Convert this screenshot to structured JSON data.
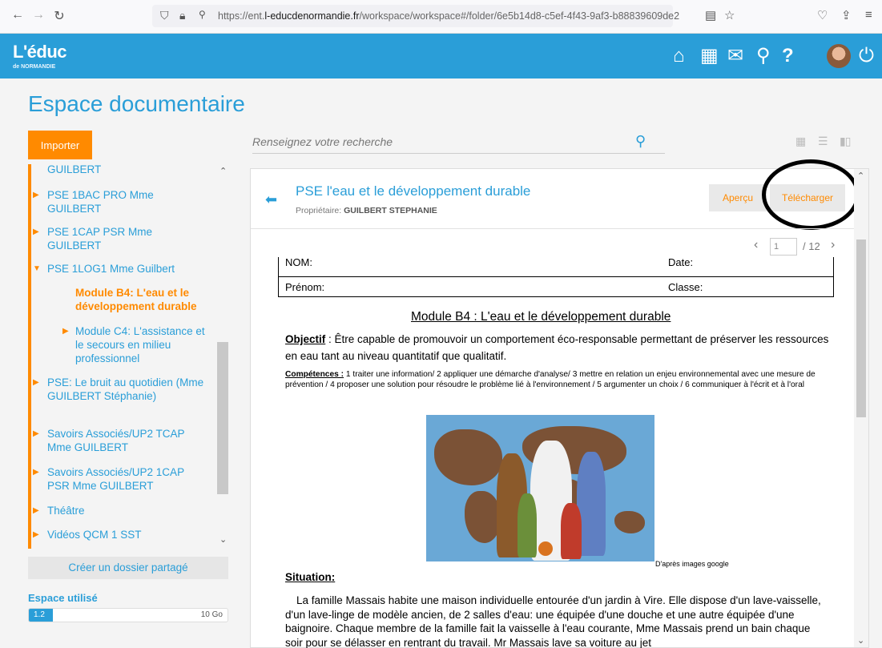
{
  "browser": {
    "url_prefix": "https://ent.",
    "url_domain": "l-educdenormandie.fr",
    "url_path": "/workspace/workspace#/folder/6e5b14d8-c5ef-4f43-9af3-b88839609de2"
  },
  "app": {
    "logo": "L'éduc",
    "logo_sub": "de NORMANDIE"
  },
  "page": {
    "title": "Espace documentaire"
  },
  "sidebar": {
    "import_label": "Importer",
    "items": [
      {
        "label": "GUILBERT"
      },
      {
        "label": "PSE 1BAC PRO Mme GUILBERT"
      },
      {
        "label": "PSE 1CAP PSR Mme GUILBERT"
      },
      {
        "label": "PSE 1LOG1 Mme Guilbert"
      },
      {
        "label": "Module B4: L'eau et le développement durable"
      },
      {
        "label": "Module C4: L'assistance et le secours en milieu professionnel"
      },
      {
        "label": "PSE: Le bruit au quotidien (Mme GUILBERT Stéphanie)"
      },
      {
        "label": "Savoirs Associés/UP2 TCAP Mme GUILBERT"
      },
      {
        "label": "Savoirs Associés/UP2 1CAP PSR Mme GUILBERT"
      },
      {
        "label": "Théâtre"
      },
      {
        "label": "Vidéos QCM 1 SST"
      }
    ],
    "share_label": "Créer un dossier partagé",
    "space_title": "Espace utilisé",
    "space_used": "1.2",
    "space_total": "10 Go",
    "space_fraction": 0.12
  },
  "search": {
    "placeholder": "Renseignez votre recherche"
  },
  "file": {
    "title": "PSE l'eau et le développement durable",
    "owner_label": "Propriétaire:",
    "owner": "GUILBERT STEPHANIE",
    "preview_label": "Aperçu",
    "download_label": "Télécharger",
    "page_current": "1",
    "page_total": "/ 12"
  },
  "document": {
    "nom": "NOM:",
    "date": "Date:",
    "prenom": "Prénom:",
    "classe": "Classe:",
    "heading": "Module B4 : L'eau et le développement durable",
    "objectif_label": "Objectif",
    "objectif_text": " : Être capable de promouvoir un comportement éco-responsable permettant de préserver les ressources en eau tant au niveau quantitatif que qualitatif.",
    "competences_label": "Compétences :",
    "competences_text": " 1 traiter une information/ 2 appliquer une démarche d'analyse/ 3 mettre en relation un enjeu environnemental avec une mesure de prévention / 4 proposer une solution pour résoudre le problème lié à l'environnement / 5 argumenter un choix / 6 communiquer à l'écrit et à l'oral",
    "image_credit": "D'après images google",
    "situation_label": "Situation",
    "situation_colon": ":",
    "situation_text": "La famille Massais habite une maison individuelle entourée d'un jardin à Vire. Elle dispose d'un lave-vaisselle, d'un lave-linge  de modèle ancien, de 2 salles d'eau: une équipée d'une douche et une autre équipée d'une baignoire. Chaque membre de la famille fait la vaisselle à l'eau courante, Mme Massais prend un bain chaque soir pour se délasser en rentrant du travail. Mr Massais lave sa voiture au jet"
  }
}
